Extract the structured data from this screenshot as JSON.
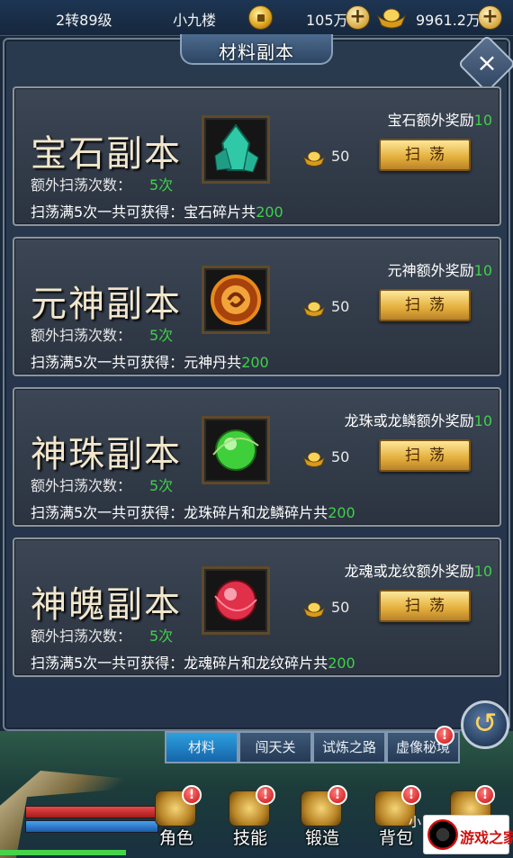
{
  "top_bar": {
    "level": "2转89级",
    "player_name": "小九楼",
    "coins": "105万",
    "ingots": "9961.2万",
    "coin_icon": "copper-coin-icon",
    "ingot_icon": "gold-ingot-icon"
  },
  "panel": {
    "title": "材料副本",
    "close_glyph": "×"
  },
  "dungeons": [
    {
      "name": "宝石副本",
      "bonus_prefix": "宝石额外奖励",
      "bonus_value": "10",
      "extra_label": "额外扫荡次数：",
      "extra_value": "5次",
      "total_prefix": "扫荡满5次一共可获得：宝石碎片共",
      "total_value": "200",
      "cost": "50",
      "button": "扫荡",
      "icon": "gem-crystal-icon",
      "icon_color": "#2fc9a8"
    },
    {
      "name": "元神副本",
      "bonus_prefix": "元神额外奖励",
      "bonus_value": "10",
      "extra_label": "额外扫荡次数：",
      "extra_value": "5次",
      "total_prefix": "扫荡满5次一共可获得：元神丹共",
      "total_value": "200",
      "cost": "50",
      "button": "扫荡",
      "icon": "spirit-orb-icon",
      "icon_color": "#e8891c"
    },
    {
      "name": "神珠副本",
      "bonus_prefix": "龙珠或龙鳞额外奖励",
      "bonus_value": "10",
      "extra_label": "额外扫荡次数：",
      "extra_value": "5次",
      "total_prefix": "扫荡满5次一共可获得：龙珠碎片和龙鳞碎片共",
      "total_value": "200",
      "cost": "50",
      "button": "扫荡",
      "icon": "dragon-pearl-icon",
      "icon_color": "#3fcf3a"
    },
    {
      "name": "神魄副本",
      "bonus_prefix": "龙魂或龙纹额外奖励",
      "bonus_value": "10",
      "extra_label": "额外扫荡次数：",
      "extra_value": "5次",
      "total_prefix": "扫荡满5次一共可获得：龙魂碎片和龙纹碎片共",
      "total_value": "200",
      "cost": "50",
      "button": "扫荡",
      "icon": "dragon-soul-icon",
      "icon_color": "#e0304a"
    }
  ],
  "sub_tabs": [
    {
      "label": "材料",
      "active": true,
      "badge": false
    },
    {
      "label": "闯天关",
      "active": false,
      "badge": false
    },
    {
      "label": "试炼之路",
      "active": false,
      "badge": false
    },
    {
      "label": "虚像秘境",
      "active": false,
      "badge": true
    }
  ],
  "nav": [
    {
      "label": "角色",
      "icon": "character-icon",
      "badge": "!"
    },
    {
      "label": "技能",
      "icon": "skill-icon",
      "badge": "!"
    },
    {
      "label": "锻造",
      "icon": "forge-icon",
      "badge": "!"
    },
    {
      "label": "背包",
      "icon": "bag-icon",
      "badge": "!"
    },
    {
      "label": "",
      "icon": "more-icon",
      "badge": "!"
    }
  ],
  "watermark": {
    "text": "游戏之家",
    "small": "小"
  },
  "colors": {
    "bonus_green": "#3fd04a",
    "button_gold": "#e3ae3b",
    "active_tab": "#2da0e0"
  }
}
